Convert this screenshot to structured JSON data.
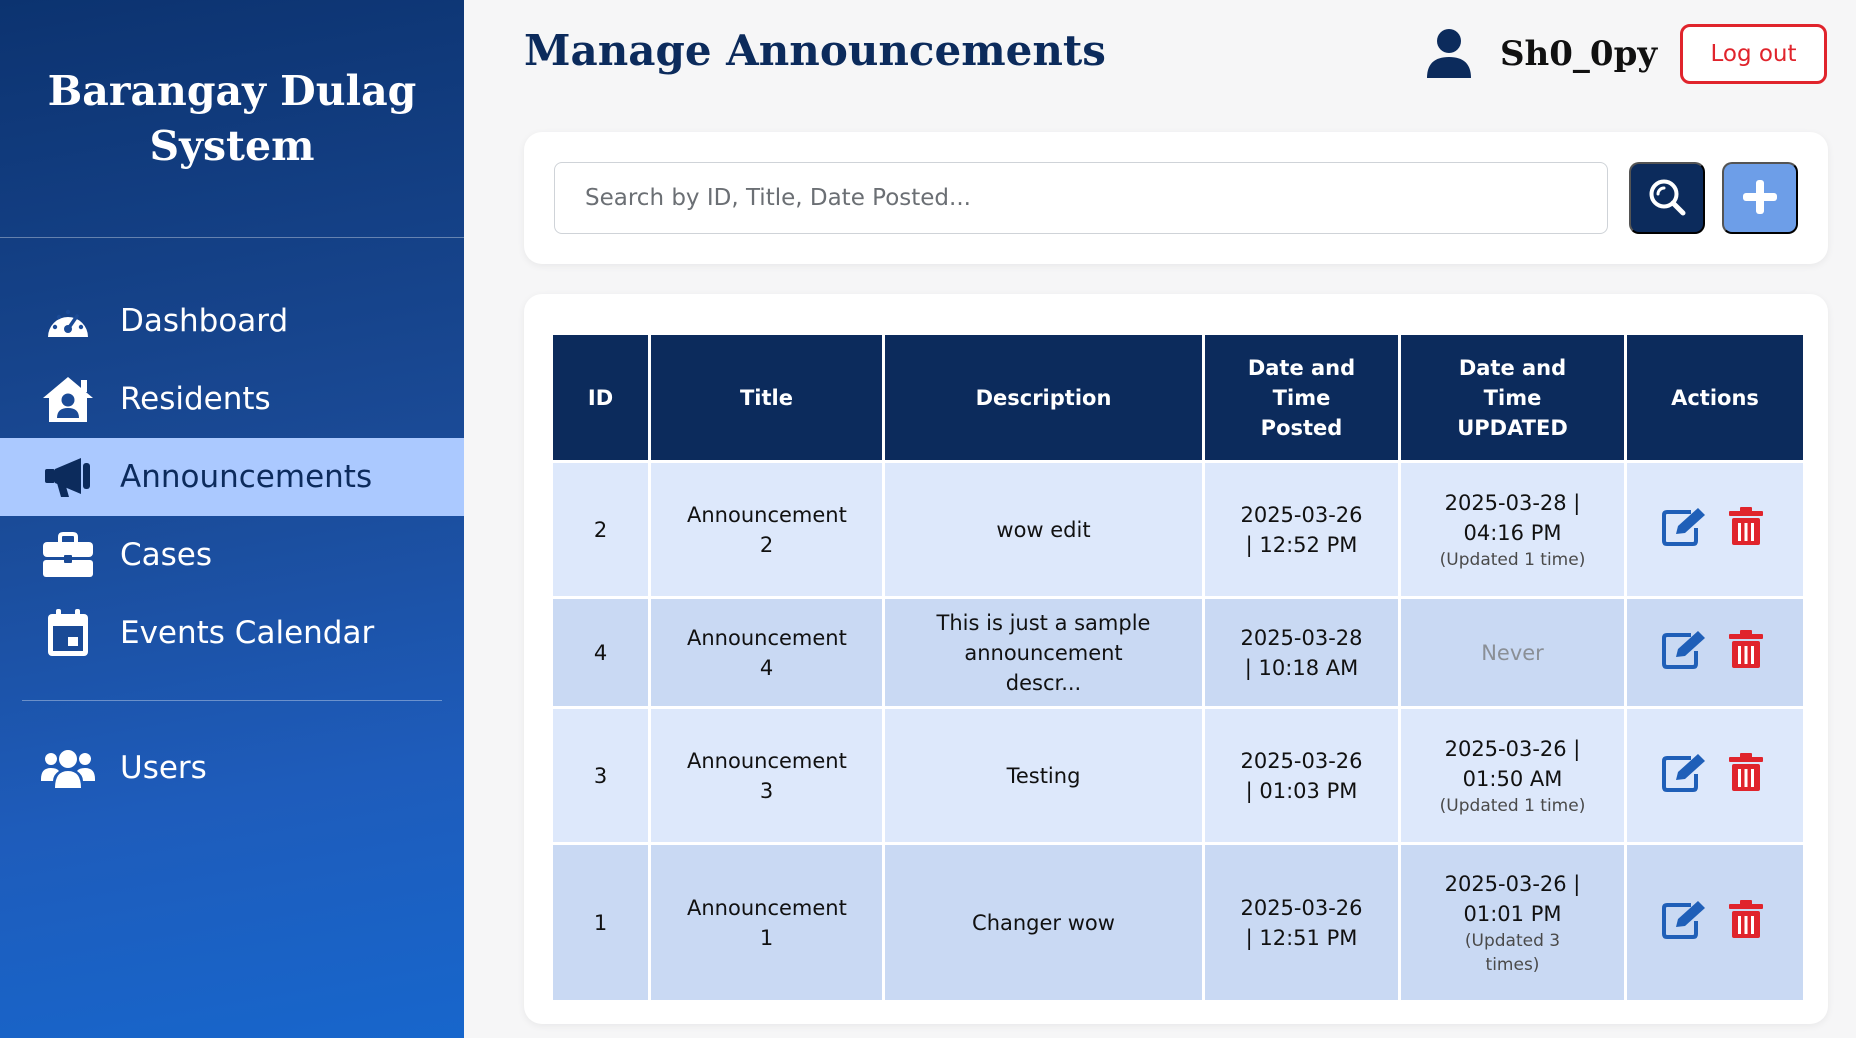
{
  "sidebar": {
    "brand": "Barangay Dulag System",
    "items": [
      {
        "label": "Dashboard",
        "icon": "gauge-icon",
        "active": false
      },
      {
        "label": "Residents",
        "icon": "house-user-icon",
        "active": false
      },
      {
        "label": "Announcements",
        "icon": "megaphone-icon",
        "active": true
      },
      {
        "label": "Cases",
        "icon": "briefcase-icon",
        "active": false
      },
      {
        "label": "Events Calendar",
        "icon": "calendar-icon",
        "active": false
      }
    ],
    "secondary_items": [
      {
        "label": "Users",
        "icon": "users-icon",
        "active": false
      }
    ]
  },
  "header": {
    "title": "Manage Announcements",
    "username": "Sh0_0py",
    "user_icon": "user-icon",
    "logout_label": "Log out"
  },
  "search": {
    "placeholder": "Search by ID, Title, Date Posted...",
    "value": "",
    "search_icon": "search-icon",
    "add_icon": "plus-icon"
  },
  "table": {
    "headers": [
      "ID",
      "Title",
      "Description",
      "Date and Time Posted",
      "Date and Time UPDATED",
      "Actions"
    ],
    "rows": [
      {
        "id": "2",
        "title": "Announcement 2",
        "description": "wow edit",
        "posted": "2025-03-26 | 12:52 PM",
        "updated": "2025-03-28 | 04:16 PM",
        "updated_note": "(Updated 1 time)"
      },
      {
        "id": "4",
        "title": "Announcement 4",
        "description": "This is just a sample announcement descr...",
        "posted": "2025-03-28 | 10:18 AM",
        "updated": "Never",
        "updated_note": ""
      },
      {
        "id": "3",
        "title": "Announcement 3",
        "description": "Testing",
        "posted": "2025-03-26 | 01:03 PM",
        "updated": "2025-03-26 | 01:50 AM",
        "updated_note": "(Updated 1 time)"
      },
      {
        "id": "1",
        "title": "Announcement 1",
        "description": "Changer wow",
        "posted": "2025-03-26 | 12:51 PM",
        "updated": "2025-03-26 | 01:01 PM",
        "updated_note": "(Updated 3 times)"
      }
    ]
  },
  "colors": {
    "navy": "#0c2b5c",
    "active_nav_bg": "#abc9ff",
    "logout_red": "#e0242c",
    "add_button_blue": "#6d9ee8",
    "delete_red": "#e0242c",
    "edit_blue": "#1f5fb8"
  }
}
